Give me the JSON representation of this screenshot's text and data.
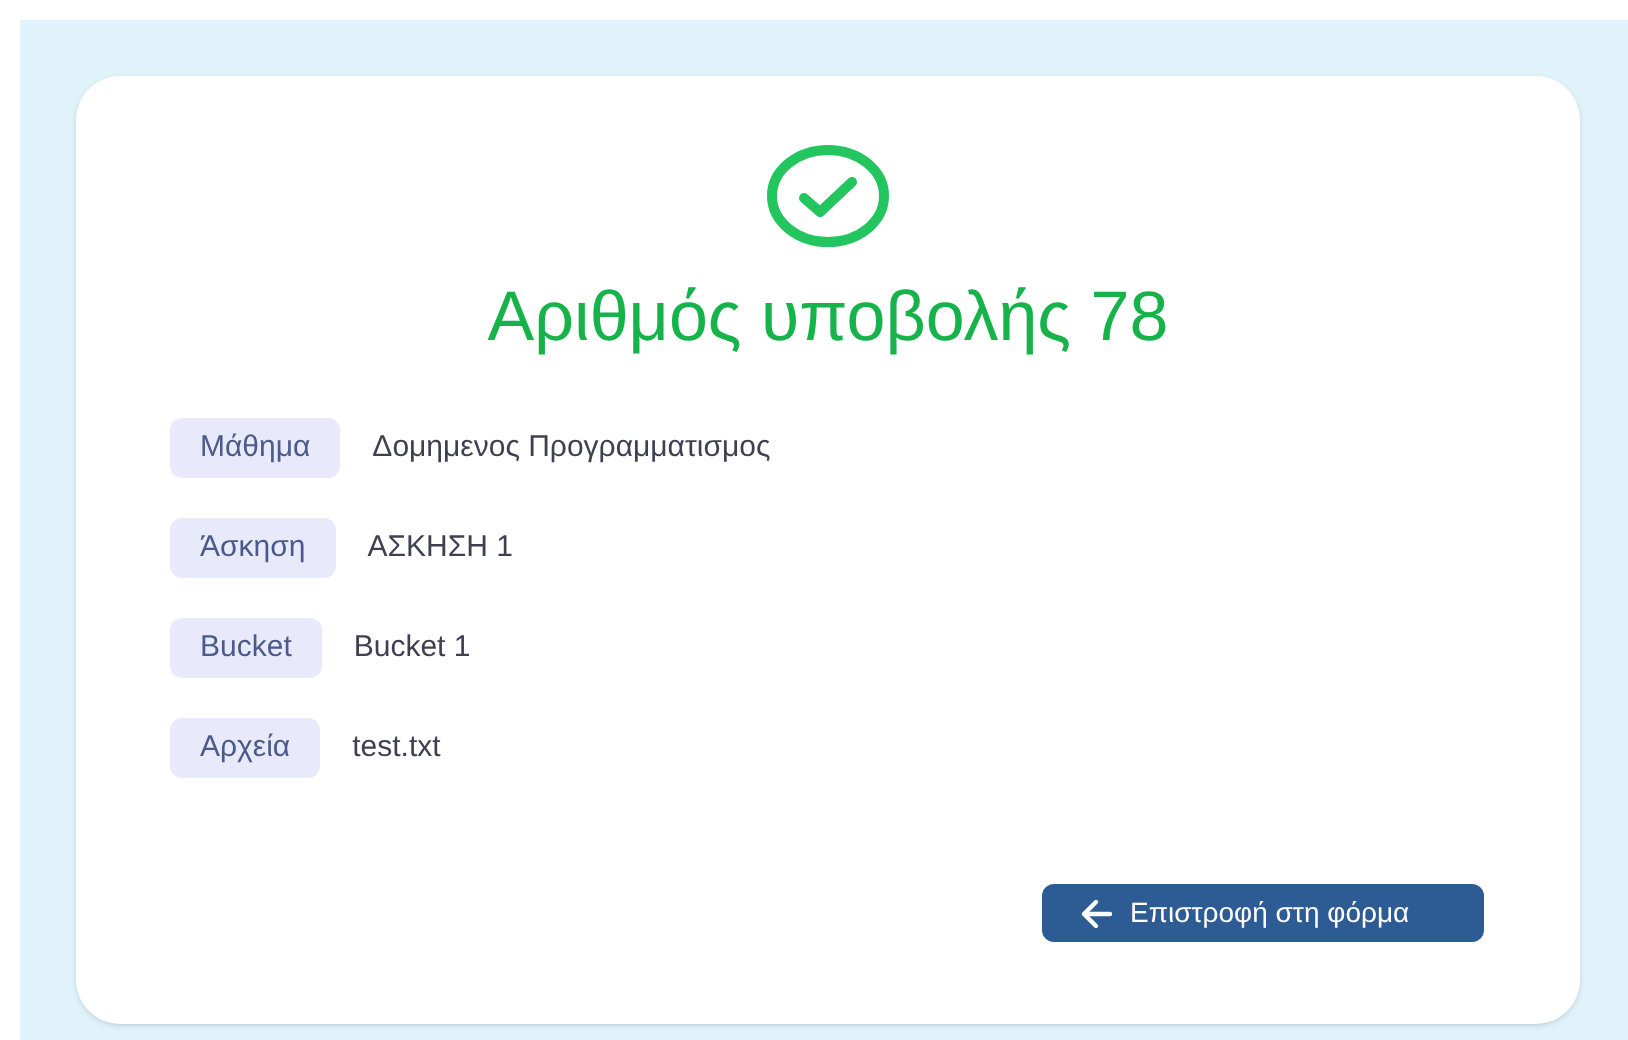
{
  "title": "Αριθμός υποβολής 78",
  "fields": [
    {
      "label": "Μάθημα",
      "value": "Δομημενος Προγραμματισμος"
    },
    {
      "label": "Άσκηση",
      "value": "ΑΣΚΗΣΗ 1"
    },
    {
      "label": "Bucket",
      "value": "Bucket 1"
    },
    {
      "label": "Αρχεία",
      "value": "test.txt"
    }
  ],
  "back_button": {
    "label": "Επιστροφή στη φόρμα"
  }
}
